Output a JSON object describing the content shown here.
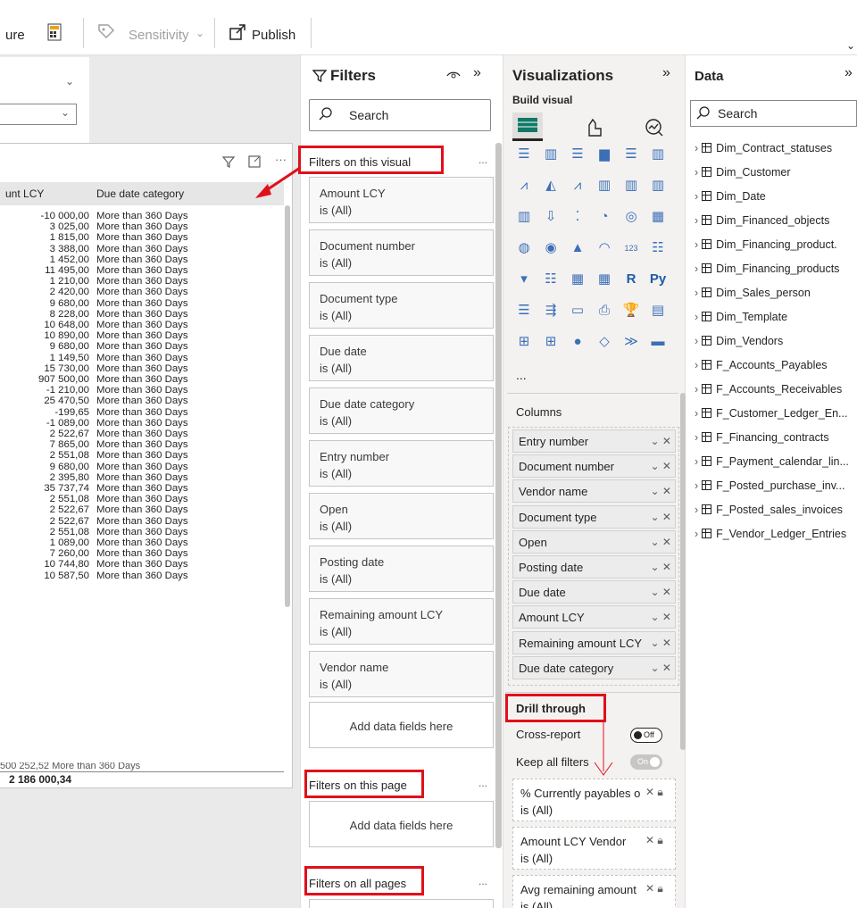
{
  "ribbon": {
    "partial_label": "ure",
    "sensitivity_label": "Sensitivity",
    "publish_label": "Publish"
  },
  "table": {
    "col1_header": "unt LCY",
    "col2_header": "Due date category",
    "rows": [
      [
        "-10 000,00",
        "More than 360 Days"
      ],
      [
        "3 025,00",
        "More than 360 Days"
      ],
      [
        "1 815,00",
        "More than 360 Days"
      ],
      [
        "3 388,00",
        "More than 360 Days"
      ],
      [
        "1 452,00",
        "More than 360 Days"
      ],
      [
        "11 495,00",
        "More than 360 Days"
      ],
      [
        "1 210,00",
        "More than 360 Days"
      ],
      [
        "2 420,00",
        "More than 360 Days"
      ],
      [
        "9 680,00",
        "More than 360 Days"
      ],
      [
        "8 228,00",
        "More than 360 Days"
      ],
      [
        "10 648,00",
        "More than 360 Days"
      ],
      [
        "10 890,00",
        "More than 360 Days"
      ],
      [
        "9 680,00",
        "More than 360 Days"
      ],
      [
        "1 149,50",
        "More than 360 Days"
      ],
      [
        "15 730,00",
        "More than 360 Days"
      ],
      [
        "907 500,00",
        "More than 360 Days"
      ],
      [
        "-1 210,00",
        "More than 360 Days"
      ],
      [
        "25 470,50",
        "More than 360 Days"
      ],
      [
        "-199,65",
        "More than 360 Days"
      ],
      [
        "-1 089,00",
        "More than 360 Days"
      ],
      [
        "2 522,67",
        "More than 360 Days"
      ],
      [
        "7 865,00",
        "More than 360 Days"
      ],
      [
        "2 551,08",
        "More than 360 Days"
      ],
      [
        "9 680,00",
        "More than 360 Days"
      ],
      [
        "2 395,80",
        "More than 360 Days"
      ],
      [
        "35 737,74",
        "More than 360 Days"
      ],
      [
        "2 551,08",
        "More than 360 Days"
      ],
      [
        "2 522,67",
        "More than 360 Days"
      ],
      [
        "2 522,67",
        "More than 360 Days"
      ],
      [
        "2 551,08",
        "More than 360 Days"
      ],
      [
        "1 089,00",
        "More than 360 Days"
      ],
      [
        "7 260,00",
        "More than 360 Days"
      ],
      [
        "10 744,80",
        "More than 360 Days"
      ],
      [
        "10 587,50",
        "More than 360 Days"
      ]
    ],
    "partial_row": "500 252,52   More than 360 Days",
    "total": "2 186 000,34"
  },
  "filters": {
    "title": "Filters",
    "search_placeholder": "Search",
    "section_visual": "Filters on this visual",
    "section_page": "Filters on this page",
    "section_all": "Filters on all pages",
    "add_fields": "Add data fields here",
    "more": "...",
    "cards": [
      {
        "name": "Amount LCY",
        "value": "is (All)"
      },
      {
        "name": "Document number",
        "value": "is (All)"
      },
      {
        "name": "Document type",
        "value": "is (All)"
      },
      {
        "name": "Due date",
        "value": "is (All)"
      },
      {
        "name": "Due date category",
        "value": "is (All)"
      },
      {
        "name": "Entry number",
        "value": "is (All)"
      },
      {
        "name": "Open",
        "value": "is (All)"
      },
      {
        "name": "Posting date",
        "value": "is (All)"
      },
      {
        "name": "Remaining amount LCY",
        "value": "is (All)"
      },
      {
        "name": "Vendor name",
        "value": "is (All)"
      }
    ]
  },
  "viz": {
    "title": "Visualizations",
    "build_visual": "Build visual",
    "more": "...",
    "columns_label": "Columns",
    "columns": [
      "Entry number",
      "Document number",
      "Vendor name",
      "Document type",
      "Open",
      "Posting date",
      "Due date",
      "Amount LCY",
      "Remaining amount LCY",
      "Due date category"
    ],
    "drill_through": "Drill through",
    "cross_report": "Cross-report",
    "cross_report_state": "Off",
    "keep_filters": "Keep all filters",
    "keep_filters_state": "On",
    "drill_cards": [
      {
        "name": "% Currently payables o",
        "value": "is (All)"
      },
      {
        "name": "Amount LCY Vendor",
        "value": "is (All)"
      },
      {
        "name": "Avg remaining amount",
        "value": "is (All)"
      }
    ]
  },
  "data": {
    "title": "Data",
    "search_placeholder": "Search",
    "items": [
      "Dim_Contract_statuses",
      "Dim_Customer",
      "Dim_Date",
      "Dim_Financed_objects",
      "Dim_Financing_product.",
      "Dim_Financing_products",
      "Dim_Sales_person",
      "Dim_Template",
      "Dim_Vendors",
      "F_Accounts_Payables",
      "F_Accounts_Receivables",
      "F_Customer_Ledger_En...",
      "F_Financing_contracts",
      "F_Payment_calendar_lin...",
      "F_Posted_purchase_inv...",
      "F_Posted_sales_invoices",
      "F_Vendor_Ledger_Entries"
    ]
  },
  "colors": {
    "highlight": "#e0101b",
    "accent": "#117865"
  }
}
